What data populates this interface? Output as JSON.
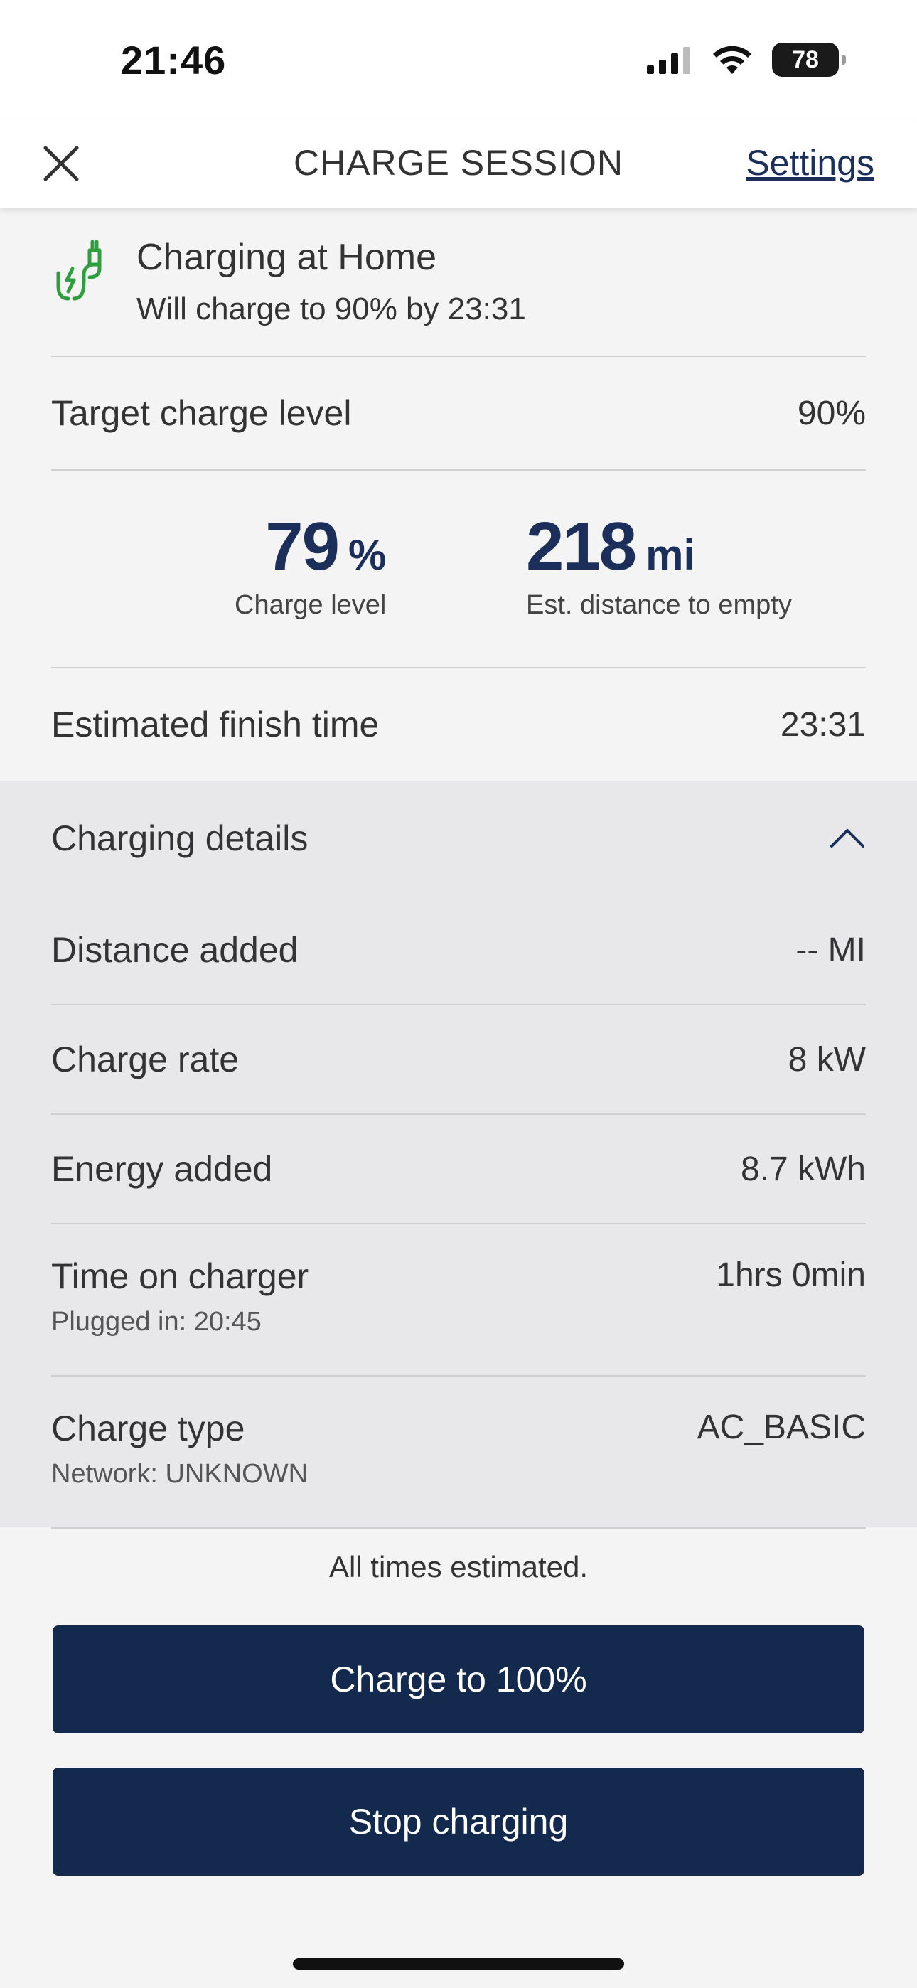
{
  "status_bar": {
    "time": "21:46",
    "battery": "78"
  },
  "header": {
    "title": "CHARGE SESSION",
    "settings_label": "Settings"
  },
  "session": {
    "title": "Charging at Home",
    "subtitle": "Will charge to 90% by 23:31"
  },
  "target": {
    "label": "Target charge level",
    "value": "90%"
  },
  "metrics": {
    "charge_value": "79",
    "charge_unit": "%",
    "charge_label": "Charge level",
    "distance_value": "218",
    "distance_unit": "mi",
    "distance_label": "Est. distance to empty"
  },
  "finish": {
    "label": "Estimated finish time",
    "value": "23:31"
  },
  "details": {
    "title": "Charging details",
    "rows": [
      {
        "label": "Distance added",
        "value": "-- MI",
        "sub": ""
      },
      {
        "label": "Charge rate",
        "value": "8 kW",
        "sub": ""
      },
      {
        "label": "Energy added",
        "value": "8.7 kWh",
        "sub": ""
      },
      {
        "label": "Time on charger",
        "value": "1hrs 0min",
        "sub": "Plugged in: 20:45"
      },
      {
        "label": "Charge type",
        "value": "AC_BASIC",
        "sub": "Network: UNKNOWN"
      }
    ]
  },
  "footnote": "All times estimated.",
  "buttons": {
    "charge_full": "Charge to 100%",
    "stop": "Stop charging"
  },
  "colors": {
    "accent": "#13294e",
    "plug_icon": "#2e9e3e",
    "text": "#333333",
    "details_bg": "#e8e8ea"
  }
}
